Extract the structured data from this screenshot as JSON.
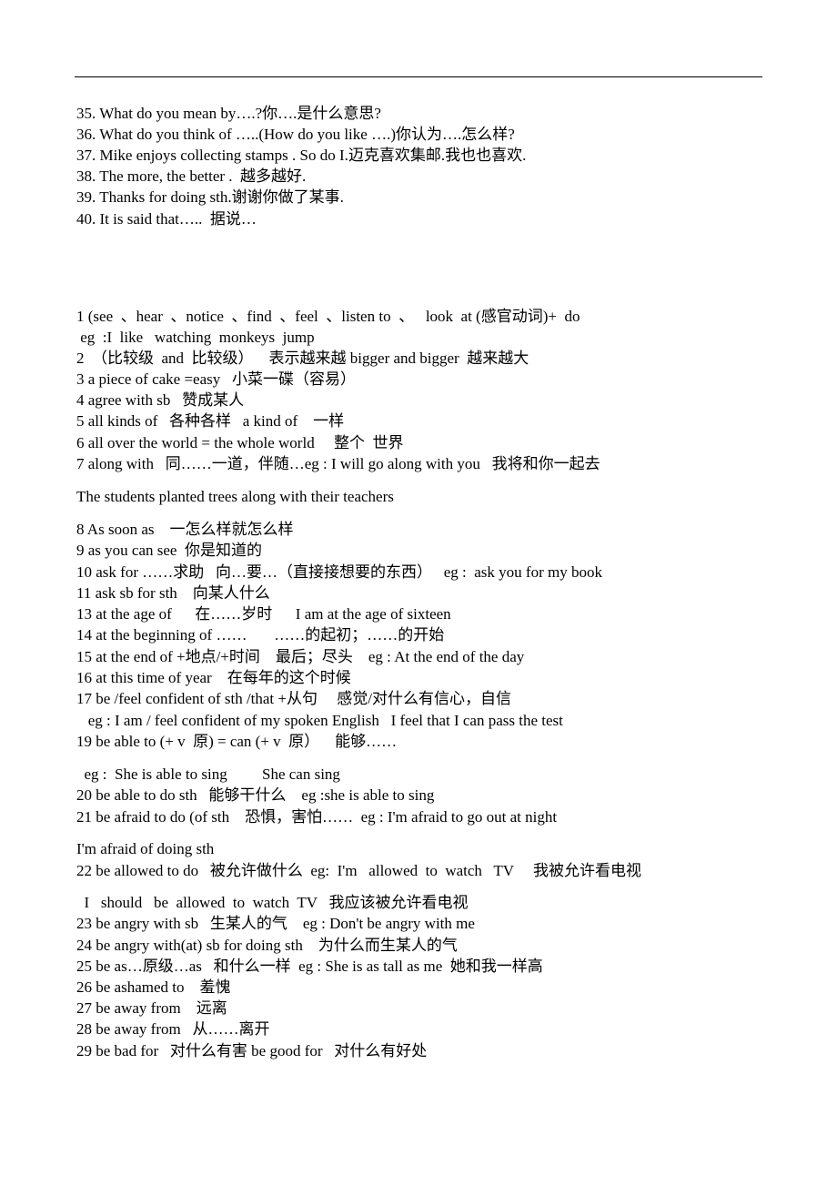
{
  "lines": [
    "35. What do you mean by….?你….是什么意思?",
    "36. What do you think of …..(How do you like ….)你认为….怎么样?",
    "37. Mike enjoys collecting stamps . So do I.迈克喜欢集邮.我也也喜欢.",
    "38. The more, the better .  越多越好.",
    "39. Thanks for doing sth.谢谢你做了某事.",
    "40. It is said that…..  据说…",
    "1 (see  、hear  、notice  、find  、feel  、listen to  、   look  at (感官动词)+  do",
    " eg  :I  like   watching  monkeys  jump",
    "2  （比较级  and  比较级）    表示越来越 bigger and bigger  越来越大",
    "3 a piece of cake =easy   小菜一碟（容易）",
    "4 agree with sb   赞成某人",
    "5 all kinds of   各种各样   a kind of    一样",
    "6 all over the world = the whole world     整个  世界",
    "7 along with   同……一道，伴随…eg : I will go along with you   我将和你一起去",
    "The students planted trees along with their teachers",
    "8 As soon as    一怎么样就怎么样",
    "9 as you can see  你是知道的",
    "10 ask for ……求助   向…要…（直接接想要的东西）   eg :  ask you for my book",
    "11 ask sb for sth    向某人什么",
    "13 at the age of      在……岁时      I am at the age of sixteen",
    "14 at the beginning of ……       ……的起初；……的开始",
    "15 at the end of +地点/+时间    最后；尽头    eg : At the end of the day",
    "16 at this time of year    在每年的这个时候",
    "17 be /feel confident of sth /that +从句     感觉/对什么有信心，自信",
    "   eg : I am / feel confident of my spoken English   I feel that I can pass the test",
    "19 be able to (+ v  原) = can (+ v  原）    能够……",
    "  eg :  She is able to sing         She can sing",
    "20 be able to do sth   能够干什么    eg :she is able to sing",
    "21 be afraid to do (of sth    恐惧，害怕……  eg : I'm afraid to go out at night",
    "I'm afraid of doing sth",
    "22 be allowed to do   被允许做什么  eg:  I'm   allowed  to  watch   TV     我被允许看电视",
    "  I   should   be  allowed  to  watch  TV   我应该被允许看电视",
    "23 be angry with sb   生某人的气    eg : Don't be angry with me",
    "24 be angry with(at) sb for doing sth    为什么而生某人的气",
    "25 be as…原级…as   和什么一样  eg : She is as tall as me  她和我一样高",
    "26 be ashamed to    羞愧",
    "27 be away from    远离",
    "28 be away from   从……离开",
    "29 be bad for   对什么有害 be good for   对什么有好处"
  ]
}
